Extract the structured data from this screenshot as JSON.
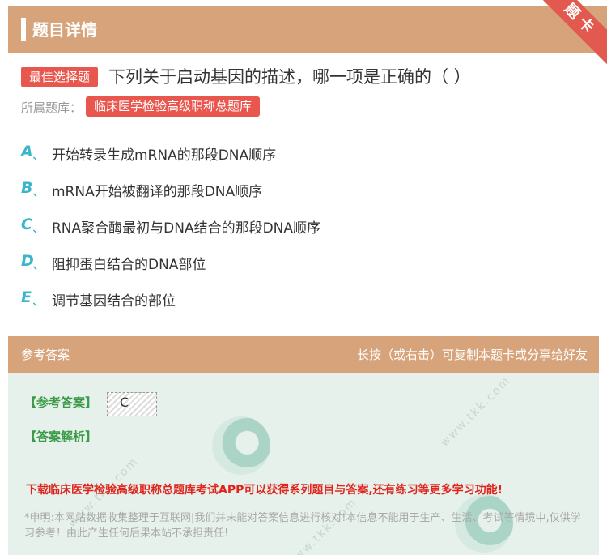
{
  "header": {
    "title": "题目详情",
    "ribbon": "题卡"
  },
  "question": {
    "type_badge": "最佳选择题",
    "text": "下列关于启动基因的描述，哪一项是正确的（ ）",
    "bank_label": "所属题库：",
    "bank_name": "临床医学检验高级职称总题库"
  },
  "options": [
    {
      "letter": "A",
      "sep": "、",
      "text": "开始转录生成mRNA的那段DNA顺序"
    },
    {
      "letter": "B",
      "sep": "、",
      "text": "mRNA开始被翻译的那段DNA顺序"
    },
    {
      "letter": "C",
      "sep": "、",
      "text": "RNA聚合酶最初与DNA结合的那段DNA顺序"
    },
    {
      "letter": "D",
      "sep": "、",
      "text": "阻抑蛋白结合的DNA部位"
    },
    {
      "letter": "E",
      "sep": "、",
      "text": "调节基因结合的部位"
    }
  ],
  "answer_bar": {
    "left": "参考答案",
    "right": "长按（或右击）可复制本题卡或分享给好友"
  },
  "answer": {
    "ref_label": "【参考答案】",
    "ref_value": "C",
    "analysis_label": "【答案解析】",
    "promo": "下载临床医学检验高级职称总题库考试APP可以获得系列题目与答案,还有练习等更多学习功能!",
    "disclaimer": "*申明:本网站数据收集整理于互联网|我们并未能对答案信息进行核对!本信息不能用于生产、生活、考试等情境中,仅供学习参考！由此产生任何后果本站不承担责任!"
  },
  "watermark": "www.tkk.com",
  "colors": {
    "header_bg": "#d7a37a",
    "badge_red": "#e8564d",
    "option_letter": "#3bb5c9",
    "answer_bg": "#e6f1ec",
    "answer_green": "#3a9a46",
    "promo_red": "#e0241c"
  }
}
